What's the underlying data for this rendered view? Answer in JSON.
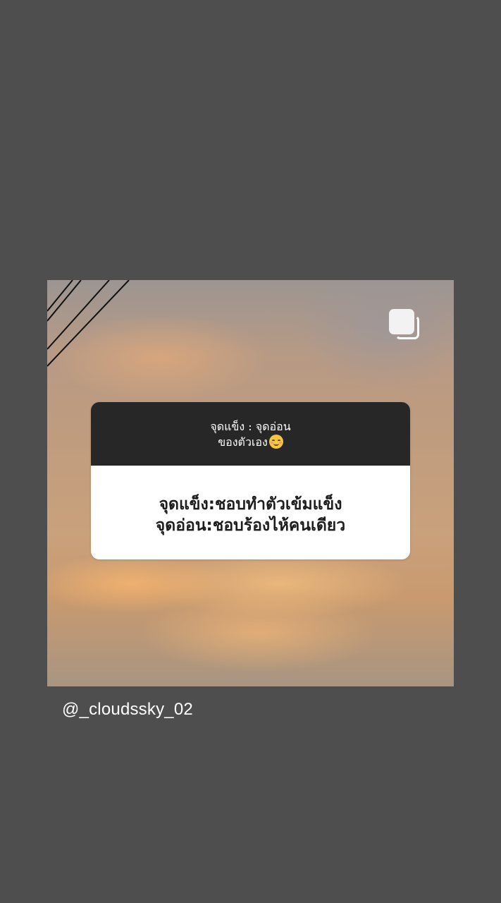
{
  "post": {
    "question_lines": [
      "จุดแข็ง : จุดอ่อน",
      "ของตัวเอง"
    ],
    "question_emoji": "smiling-face-icon",
    "answer_lines": [
      "จุดแข็ง:ชอบทำตัวเข้มแข็ง",
      "จุดอ่อน:ชอบร้องไห้คนเดียว"
    ],
    "multi_post_icon": "multiple-images-icon"
  },
  "username": "@_cloudssky_02",
  "colors": {
    "background": "#4e4e4e",
    "question_bg": "#272727",
    "answer_bg": "#ffffff"
  }
}
